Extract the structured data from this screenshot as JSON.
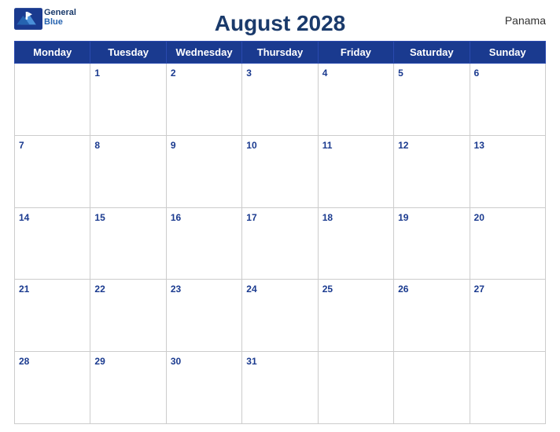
{
  "header": {
    "title": "August 2028",
    "country": "Panama",
    "logo_general": "General",
    "logo_blue": "Blue"
  },
  "days_of_week": [
    "Monday",
    "Tuesday",
    "Wednesday",
    "Thursday",
    "Friday",
    "Saturday",
    "Sunday"
  ],
  "weeks": [
    [
      null,
      1,
      2,
      3,
      4,
      5,
      6
    ],
    [
      7,
      8,
      9,
      10,
      11,
      12,
      13
    ],
    [
      14,
      15,
      16,
      17,
      18,
      19,
      20
    ],
    [
      21,
      22,
      23,
      24,
      25,
      26,
      27
    ],
    [
      28,
      29,
      30,
      31,
      null,
      null,
      null
    ]
  ]
}
